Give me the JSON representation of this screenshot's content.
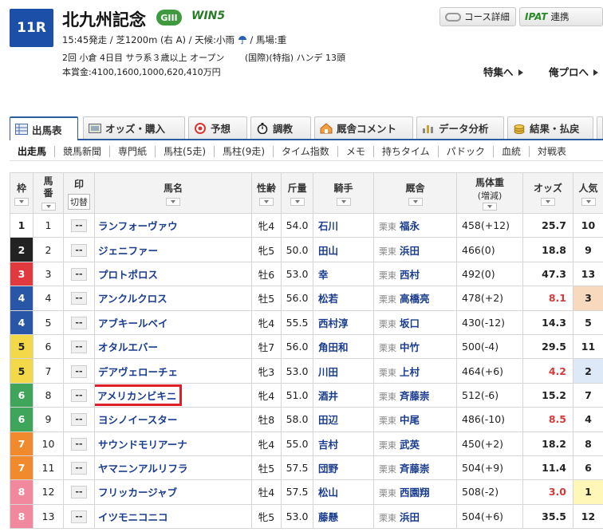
{
  "race": {
    "number": "11R",
    "title": "北九州記念",
    "grade": "GIII",
    "win5": "WIN5",
    "info_line1_a": "15:45発走 / 芝1200m (右 A) / 天候:小雨",
    "info_line1_b": "/ 馬場:重",
    "info_line2": "2回 小倉 4日目 サラ系３歳以上 オープン 　　(国際)(特指) ハンデ 13頭",
    "info_line3": "本賞金:4100,1600,1000,620,410万円"
  },
  "header_buttons": {
    "course": "コース詳細",
    "ipat_logo": "IPAT",
    "ipat": "連携"
  },
  "links": {
    "feature": "特集へ",
    "pro": "俺プロへ"
  },
  "main_tabs": [
    {
      "label": "出馬表"
    },
    {
      "label": "オッズ・購入"
    },
    {
      "label": "予想"
    },
    {
      "label": "調教"
    },
    {
      "label": "厩舎コメント"
    },
    {
      "label": "データ分析"
    },
    {
      "label": "結果・払戻"
    }
  ],
  "sub_tabs": [
    "出走馬",
    "競馬新聞",
    "専門紙",
    "馬柱(5走)",
    "馬柱(9走)",
    "タイム指数",
    "メモ",
    "持ちタイム",
    "パドック",
    "血統",
    "対戦表"
  ],
  "table_header": {
    "waku": "枠",
    "umaban": "馬番",
    "mark": "印",
    "mark_toggle": "切替",
    "name": "馬名",
    "sexage": "性齢",
    "kinryo": "斤量",
    "jockey": "騎手",
    "trainer": "厩舎",
    "weight": "馬体重",
    "weight_sub": "(増減)",
    "odds": "オッズ",
    "popularity": "人気"
  },
  "colors": {
    "waku_1": "#ffffff",
    "waku_2": "#222222",
    "waku_3": "#e0393e",
    "waku_4": "#2a56a8",
    "waku_5": "#f3d94a",
    "waku_6": "#3fa55a",
    "waku_7": "#f08a2c",
    "waku_8": "#f2889d",
    "highlight": "#e01e2a"
  },
  "mark_placeholder": "--",
  "horses": [
    {
      "waku": "1",
      "umaban": "1",
      "name": "ランフォーヴァウ",
      "sexage": "牝4",
      "kinryo": "54.0",
      "jockey": "石川",
      "area": "栗東",
      "trainer": "福永",
      "weight": "458(+12)",
      "odds": "25.7",
      "pop": "10"
    },
    {
      "waku": "2",
      "umaban": "2",
      "name": "ジェニファー",
      "sexage": "牝5",
      "kinryo": "50.0",
      "jockey": "田山",
      "area": "栗東",
      "trainer": "浜田",
      "weight": "466(0)",
      "odds": "18.8",
      "pop": "9"
    },
    {
      "waku": "3",
      "umaban": "3",
      "name": "プロトポロス",
      "sexage": "牡6",
      "kinryo": "53.0",
      "jockey": "幸",
      "area": "栗東",
      "trainer": "西村",
      "weight": "492(0)",
      "odds": "47.3",
      "pop": "13"
    },
    {
      "waku": "4",
      "umaban": "4",
      "name": "アンクルクロス",
      "sexage": "牡5",
      "kinryo": "56.0",
      "jockey": "松若",
      "area": "栗東",
      "trainer": "高橋亮",
      "weight": "478(+2)",
      "odds": "8.1",
      "pop": "3"
    },
    {
      "waku": "4",
      "umaban": "5",
      "name": "アブキールベイ",
      "sexage": "牝4",
      "kinryo": "55.5",
      "jockey": "西村淳",
      "area": "栗東",
      "trainer": "坂口",
      "weight": "430(-12)",
      "odds": "14.3",
      "pop": "5"
    },
    {
      "waku": "5",
      "umaban": "6",
      "name": "オタルエバー",
      "sexage": "牡7",
      "kinryo": "56.0",
      "jockey": "角田和",
      "area": "栗東",
      "trainer": "中竹",
      "weight": "500(-4)",
      "odds": "29.5",
      "pop": "11"
    },
    {
      "waku": "5",
      "umaban": "7",
      "name": "デアヴェローチェ",
      "sexage": "牝3",
      "kinryo": "53.0",
      "jockey": "川田",
      "area": "栗東",
      "trainer": "上村",
      "weight": "464(+6)",
      "odds": "4.2",
      "pop": "2"
    },
    {
      "waku": "6",
      "umaban": "8",
      "name": "アメリカンビキニ",
      "sexage": "牝4",
      "kinryo": "51.0",
      "jockey": "酒井",
      "area": "栗東",
      "trainer": "斉藤崇",
      "weight": "512(-6)",
      "odds": "15.2",
      "pop": "7"
    },
    {
      "waku": "6",
      "umaban": "9",
      "name": "ヨシノイースター",
      "sexage": "牡8",
      "kinryo": "58.0",
      "jockey": "田辺",
      "area": "栗東",
      "trainer": "中尾",
      "weight": "486(-10)",
      "odds": "8.5",
      "pop": "4"
    },
    {
      "waku": "7",
      "umaban": "10",
      "name": "サウンドモリアーナ",
      "sexage": "牝4",
      "kinryo": "55.0",
      "jockey": "吉村",
      "area": "栗東",
      "trainer": "武英",
      "weight": "450(+2)",
      "odds": "18.2",
      "pop": "8"
    },
    {
      "waku": "7",
      "umaban": "11",
      "name": "ヤマニンアルリフラ",
      "sexage": "牡5",
      "kinryo": "57.5",
      "jockey": "団野",
      "area": "栗東",
      "trainer": "斉藤崇",
      "weight": "504(+9)",
      "odds": "11.4",
      "pop": "6"
    },
    {
      "waku": "8",
      "umaban": "12",
      "name": "フリッカージャブ",
      "sexage": "牡4",
      "kinryo": "57.5",
      "jockey": "松山",
      "area": "栗東",
      "trainer": "西園翔",
      "weight": "508(-2)",
      "odds": "3.0",
      "pop": "1"
    },
    {
      "waku": "8",
      "umaban": "13",
      "name": "イツモニコニコ",
      "sexage": "牝5",
      "kinryo": "53.0",
      "jockey": "藤懸",
      "area": "栗東",
      "trainer": "浜田",
      "weight": "504(+6)",
      "odds": "35.5",
      "pop": "12"
    }
  ]
}
